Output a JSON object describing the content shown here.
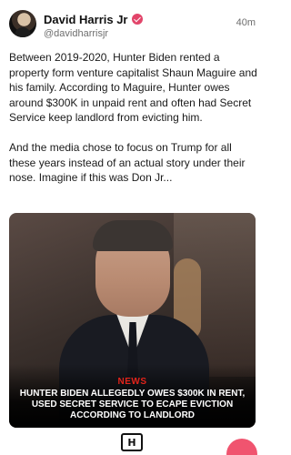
{
  "author": {
    "display_name": "David Harris Jr",
    "handle": "@davidharrisjr",
    "timestamp": "40m"
  },
  "post": {
    "paragraph_1": "Between 2019-2020, Hunter Biden rented a property form venture capitalist Shaun Maguire and his family. According to Maguire, Hunter owes around $300K in unpaid rent and often had Secret Service keep landlord from evicting him.",
    "paragraph_2": "And the media chose to focus on Trump for all these years instead of an actual story under their nose. Imagine if this was Don Jr..."
  },
  "media": {
    "tag": "NEWS",
    "headline": "HUNTER BIDEN ALLEGEDLY OWES $300K IN RENT, USED SECRET SERVICE TO ECAPE EVICTION ACCORDING TO LANDLORD",
    "logo_icon": "brand-logo-icon"
  },
  "icons": {
    "verified": "verified-badge-icon",
    "fab": "compose-button"
  },
  "colors": {
    "verified_badge": "#e2456a",
    "news_tag": "#e2231a",
    "fab": "#f0546f"
  }
}
